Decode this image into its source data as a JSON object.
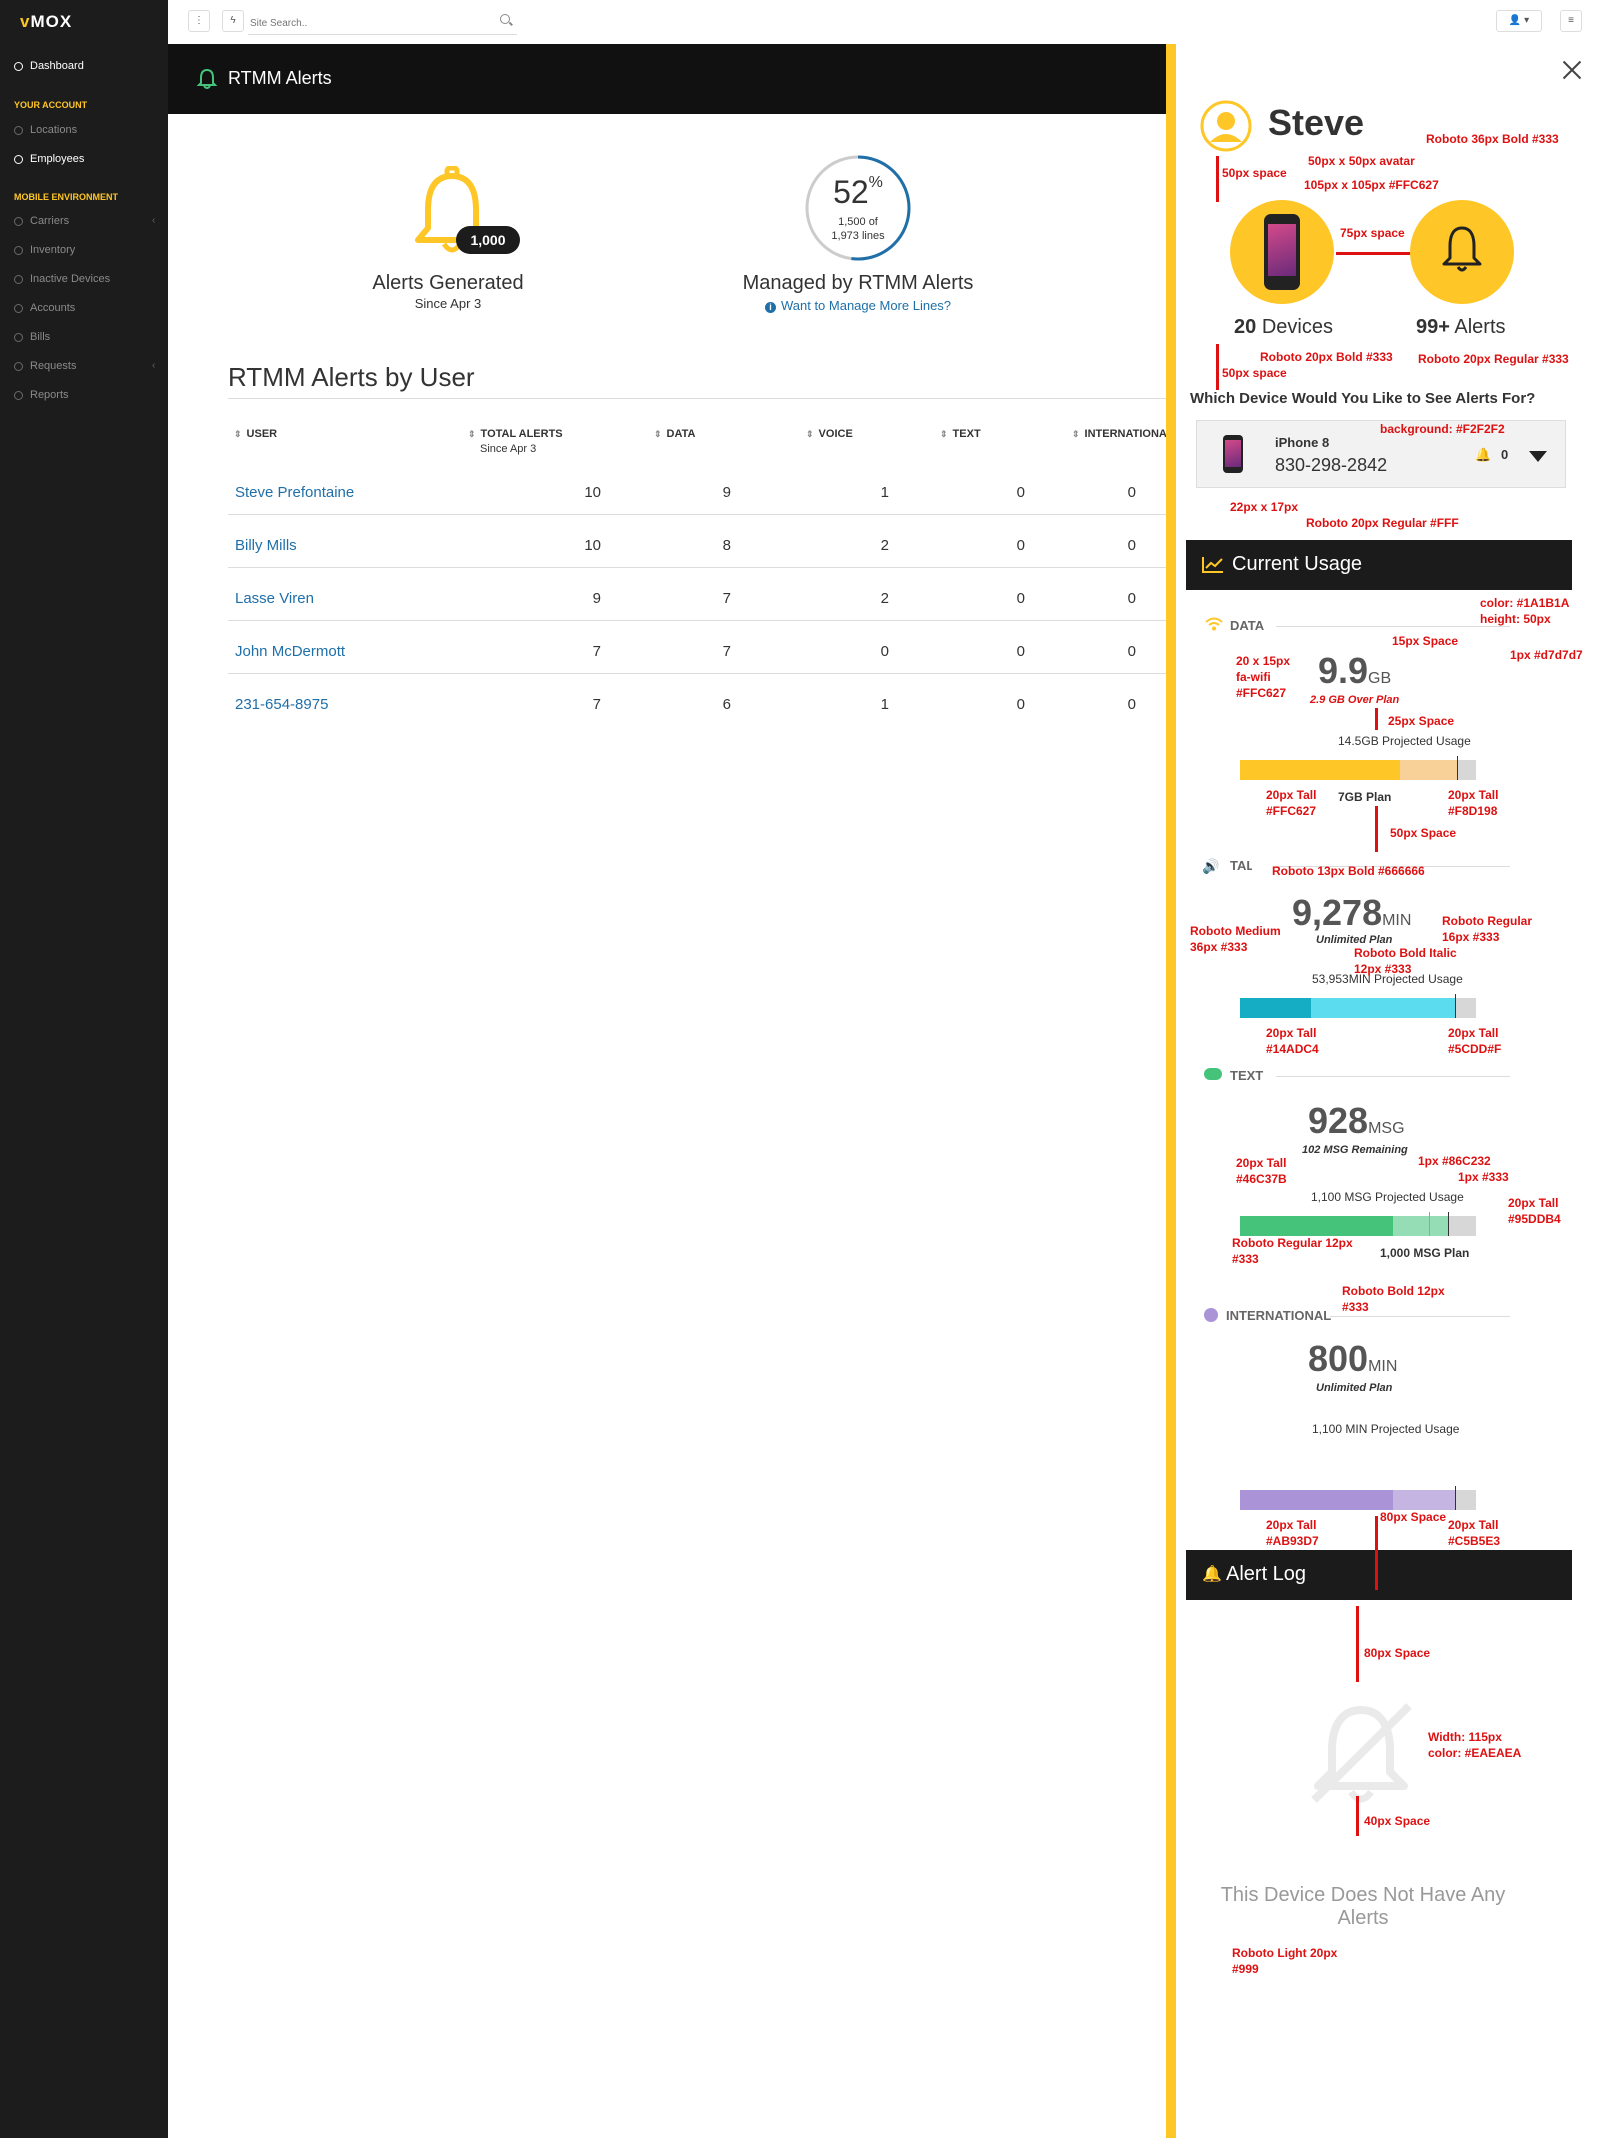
{
  "sidebar": {
    "logo": "MOX",
    "logo_mark": "v",
    "dashboard": "Dashboard",
    "section_account": "YOUR ACCOUNT",
    "locations": "Locations",
    "employees": "Employees",
    "section_mobile": "MOBILE ENVIRONMENT",
    "carriers": "Carriers",
    "inventory": "Inventory",
    "inactive_devices": "Inactive Devices",
    "accounts": "Accounts",
    "bills": "Bills",
    "requests": "Requests",
    "reports": "Reports"
  },
  "topbar": {
    "search_placeholder": "Site Search.."
  },
  "page": {
    "title": "RTMM Alerts"
  },
  "stats": {
    "alerts_badge": "1,000",
    "alerts_label": "Alerts Generated",
    "alerts_since": "Since Apr 3",
    "managed_pct": "52",
    "managed_pct_sym": "%",
    "managed_of": "1,500 of",
    "managed_total": "1,973 lines",
    "managed_fraction": 0.52,
    "managed_label": "Managed by RTMM Alerts",
    "managed_link": "Want to Manage More Lines?"
  },
  "table": {
    "title": "RTMM Alerts by User",
    "headers": {
      "user": "USER",
      "total": "TOTAL ALERTS",
      "total_sub": "Since Apr 3",
      "data": "DATA",
      "voice": "VOICE",
      "text": "TEXT",
      "intl": "INTERNATIONA"
    },
    "rows": [
      {
        "user": "Steve Prefontaine",
        "total": "10",
        "data": "9",
        "voice": "1",
        "text": "0",
        "intl": "0"
      },
      {
        "user": "Billy Mills",
        "total": "10",
        "data": "8",
        "voice": "2",
        "text": "0",
        "intl": "0"
      },
      {
        "user": "Lasse Viren",
        "total": "9",
        "data": "7",
        "voice": "2",
        "text": "0",
        "intl": "0"
      },
      {
        "user": "John McDermott",
        "total": "7",
        "data": "7",
        "voice": "0",
        "text": "0",
        "intl": "0"
      },
      {
        "user": "231-654-8975",
        "total": "7",
        "data": "6",
        "voice": "1",
        "text": "0",
        "intl": "0"
      }
    ]
  },
  "panel": {
    "name": "Steve",
    "devices_count": "20",
    "devices_label": "Devices",
    "alerts_count": "99+",
    "alerts_label": "Alerts",
    "device_question": "Which Device Would You Like to See Alerts For?",
    "device_name": "iPhone 8",
    "device_number": "830-298-2842",
    "device_alerts": "0",
    "current_usage": "Current Usage",
    "data": {
      "label": "DATA",
      "value": "9.9",
      "unit": "GB",
      "over": "2.9 GB  Over Plan",
      "projected": "14.5GB Projected Usage",
      "plan": "7GB Plan",
      "used_fraction": 0.68,
      "proj_fraction": 0.92,
      "plan_fraction": 0.48
    },
    "talk": {
      "label": "TALK",
      "value": "9,278",
      "unit": "MIN",
      "plan": "Unlimited Plan",
      "projected": "53,953MIN Projected Usage",
      "used_fraction": 0.3,
      "proj_fraction": 0.91
    },
    "text": {
      "label": "TEXT",
      "value": "928",
      "unit": "MSG",
      "remaining": "102 MSG Remaining",
      "projected": "1,100 MSG Projected Usage",
      "plan": "1,000 MSG Plan",
      "used_fraction": 0.65,
      "proj_fraction": 0.88,
      "plan_fraction": 0.8
    },
    "international": {
      "label": "INTERNATIONAL",
      "value": "800",
      "unit": "MIN",
      "plan": "Unlimited Plan",
      "projected": "1,100 MIN Projected Usage",
      "used_fraction": 0.65,
      "proj_fraction": 0.91
    },
    "alert_log": "Alert Log",
    "no_alerts": "This Device Does Not Have Any Alerts"
  },
  "annotations": {
    "a1": "Roboto 36px Bold #333",
    "a2": "50px x 50px avatar",
    "a3": "50px space",
    "a4": "105px x 105px #FFC627",
    "a5": "75px space",
    "a6": "Roboto 20px Bold #333",
    "a7": "Roboto 20px Regular #333",
    "a8": "50px space",
    "a9": "background: #F2F2F2",
    "a10": "22px x 17px",
    "a11": "Roboto 20px Regular #FFF",
    "a12": "color: #1A1B1A",
    "a12b": "height: 50px",
    "a13": "1px #d7d7d7",
    "a14": "15px Space",
    "a15": "20 x 15px",
    "a15b": "fa-wifi",
    "a15c": "#FFC627",
    "a16": "25px Space",
    "a17": "20px Tall",
    "a17b": "#FFC627",
    "a18": "20px Tall",
    "a18b": "#F8D198",
    "a19": "50px Space",
    "a20": "Roboto 13px Bold #666666",
    "a21": "Roboto Regular",
    "a21b": "16px #333",
    "a22": "Roboto Medium",
    "a22b": "36px #333",
    "a23": "Roboto Bold Italic",
    "a23b": "12px #333",
    "a24": "20px Tall",
    "a24b": "#14ADC4",
    "a25": "20px Tall",
    "a25b": "#5CDD#F",
    "a26": "20px Tall",
    "a26b": "#46C37B",
    "a27": "1px #86C232",
    "a28": "1px #333",
    "a29": "20px Tall",
    "a29b": "#95DDB4",
    "a30": "Roboto Regular 12px",
    "a30b": "#333",
    "a31": "Roboto Bold 12px",
    "a31b": "#333",
    "a32": "20px Tall",
    "a32b": "#AB93D7",
    "a33": "20px Tall",
    "a33b": "#C5B5E3",
    "a34": "80px Space",
    "a35": "80px Space",
    "a36": "Width: 115px",
    "a36b": "color: #EAEAEA",
    "a37": "40px Space",
    "a38": "Roboto Light 20px",
    "a38b": "#999"
  },
  "colors": {
    "accent": "#FFC627",
    "data_used": "#FFC627",
    "data_over": "#F8D198",
    "talk_used": "#14ADC4",
    "talk_proj": "#5CDDEF",
    "text_used": "#46C37B",
    "text_proj": "#95DDB4",
    "intl_used": "#AB93D7",
    "intl_proj": "#C5B5E3",
    "bar_bg": "#d7d7d7",
    "dark": "#1A1B1A"
  }
}
